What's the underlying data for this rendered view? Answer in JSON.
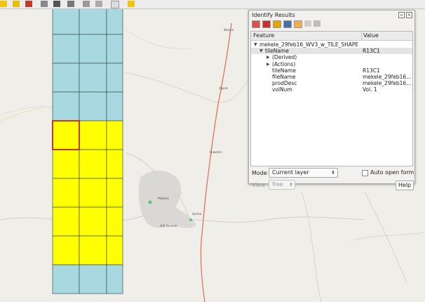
{
  "toolbar": {
    "icons": [
      "layer-icon",
      "save-icon",
      "bug-icon",
      "tag-icon",
      "label-icon",
      "label-icon",
      "zoom-icon",
      "select-icon",
      "pin-icon"
    ]
  },
  "map": {
    "place_labels": [
      "Mekele",
      "Hawzen",
      "Quiha",
      "Adi Gudem",
      "Agula",
      "Wukro"
    ],
    "tiles": {
      "columns": 3,
      "rows": 10,
      "highlight_color": "#ffff00",
      "base_color": "#a8d8e0",
      "selected_tile_border": "#c0392b"
    }
  },
  "panel": {
    "title": "Identify Results",
    "headers": {
      "feature": "Feature",
      "value": "Value"
    },
    "rows": [
      {
        "key": "mekele_29feb16_WV3_w_TILE_SHAPE",
        "value": "",
        "indent": 0,
        "arrow": "▼"
      },
      {
        "key": "tileName",
        "value": "R13C1",
        "indent": 1,
        "arrow": "▼"
      },
      {
        "key": "(Derived)",
        "value": "",
        "indent": 2,
        "arrow": "▶"
      },
      {
        "key": "(Actions)",
        "value": "",
        "indent": 2,
        "arrow": "▶"
      },
      {
        "key": "tileName",
        "value": "R13C1",
        "indent": 2,
        "arrow": ""
      },
      {
        "key": "fileName",
        "value": "mekele_29feb16_...",
        "indent": 2,
        "arrow": ""
      },
      {
        "key": "prodDesc",
        "value": "mekele_29feb16_...",
        "indent": 2,
        "arrow": ""
      },
      {
        "key": "volNum",
        "value": "Vol. 1",
        "indent": 2,
        "arrow": ""
      }
    ],
    "mode_label": "Mode",
    "mode_value": "Current layer",
    "auto_open_label": "Auto open form",
    "view_label": "View",
    "view_value": "Tree",
    "help_label": "Help"
  }
}
